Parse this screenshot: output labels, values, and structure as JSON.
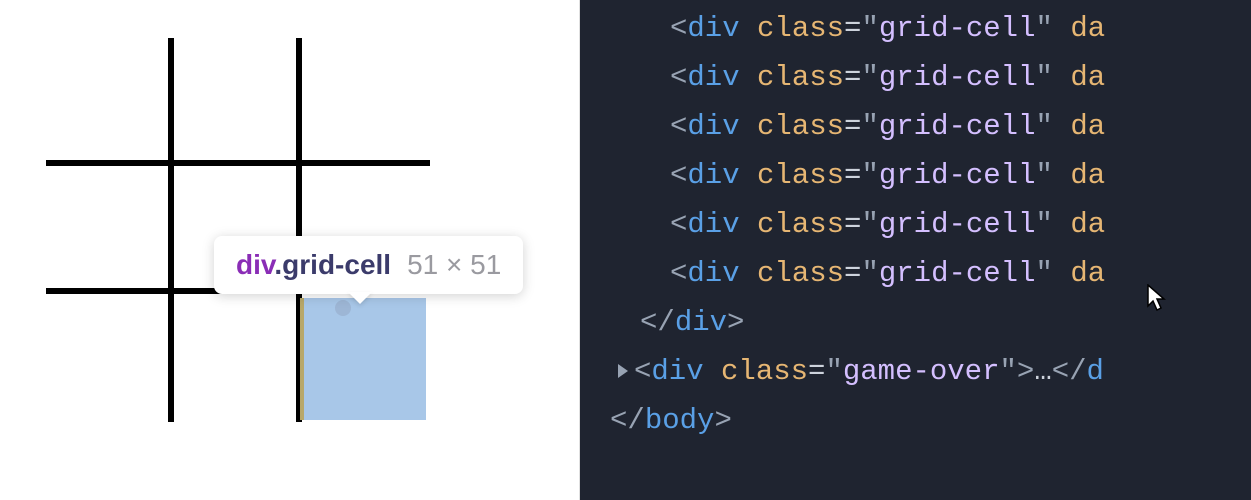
{
  "tooltip": {
    "tag": "div",
    "cls": ".grid-cell",
    "dims": "51 × 51"
  },
  "code": {
    "div_open": "div",
    "class_attr": "class",
    "grid_cell_val": "grid-cell",
    "trailing_attr_frag": "da",
    "div_close": "div",
    "game_over_val": "game-over",
    "ellipsis": "…",
    "d_frag": "d",
    "body_close": "body"
  }
}
